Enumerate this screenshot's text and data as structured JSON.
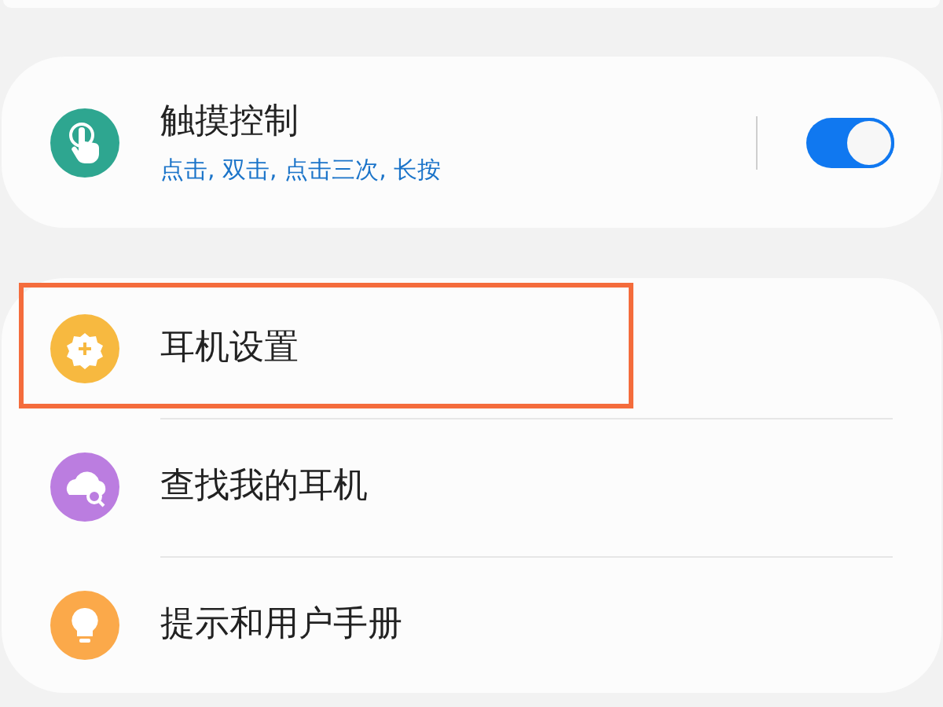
{
  "touch_control": {
    "title": "触摸控制",
    "subtitle": "点击, 双击, 点击三次, 长按",
    "on": true
  },
  "menu": [
    {
      "kind": "settings",
      "label": "耳机设置",
      "highlighted": true
    },
    {
      "kind": "find",
      "label": "查找我的耳机",
      "highlighted": false
    },
    {
      "kind": "tips",
      "label": "提示和用户手册",
      "highlighted": false
    }
  ]
}
